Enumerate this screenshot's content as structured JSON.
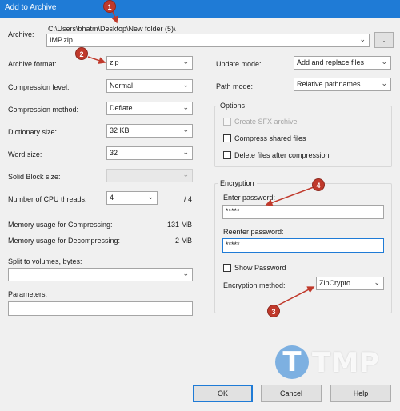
{
  "window": {
    "title": "Add to Archive"
  },
  "archive": {
    "label": "Archive:",
    "path": "C:\\Users\\bhatm\\Desktop\\New folder (5)\\",
    "filename": "IMP.zip",
    "browse_label": "..."
  },
  "left": {
    "archive_format": {
      "label": "Archive format:",
      "value": "zip"
    },
    "compression_level": {
      "label": "Compression level:",
      "value": "Normal"
    },
    "compression_method": {
      "label": "Compression method:",
      "value": "Deflate"
    },
    "dictionary_size": {
      "label": "Dictionary size:",
      "value": "32 KB"
    },
    "word_size": {
      "label": "Word size:",
      "value": "32"
    },
    "solid_block_size": {
      "label": "Solid Block size:",
      "value": ""
    },
    "cpu_threads": {
      "label": "Number of CPU threads:",
      "value": "4",
      "suffix": "/ 4"
    },
    "memory_compress": {
      "label": "Memory usage for Compressing:",
      "value": "131 MB"
    },
    "memory_decompress": {
      "label": "Memory usage for Decompressing:",
      "value": "2 MB"
    },
    "split_volumes": {
      "label": "Split to volumes, bytes:",
      "value": ""
    },
    "parameters": {
      "label": "Parameters:",
      "value": ""
    }
  },
  "right": {
    "update_mode": {
      "label": "Update mode:",
      "value": "Add and replace files"
    },
    "path_mode": {
      "label": "Path mode:",
      "value": "Relative pathnames"
    },
    "options": {
      "title": "Options",
      "create_sfx": "Create SFX archive",
      "compress_shared": "Compress shared files",
      "delete_after": "Delete files after compression"
    },
    "encryption": {
      "title": "Encryption",
      "enter_password_label": "Enter password:",
      "enter_password_value": "*****",
      "reenter_password_label": "Reenter password:",
      "reenter_password_value": "*****",
      "show_password": "Show Password",
      "method_label": "Encryption method:",
      "method_value": "ZipCrypto"
    }
  },
  "buttons": {
    "ok": "OK",
    "cancel": "Cancel",
    "help": "Help"
  },
  "markers": [
    "1",
    "2",
    "3",
    "4"
  ],
  "watermark": {
    "letter": "T",
    "text": "TMP"
  },
  "icons": {
    "dropdown": "chevron-down-icon"
  },
  "colors": {
    "accent": "#1f7bd6",
    "marker": "#c0392b"
  }
}
